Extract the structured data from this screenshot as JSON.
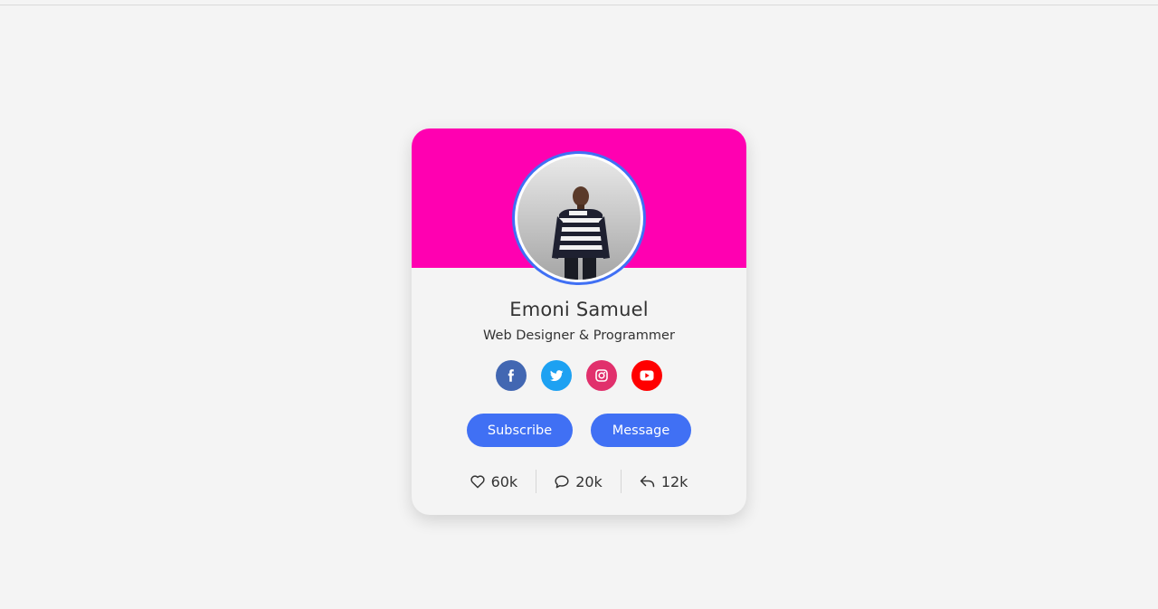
{
  "profile": {
    "name": "Emoni Samuel",
    "role": "Web Designer & Programmer"
  },
  "socials": [
    {
      "network": "facebook",
      "icon": "facebook-icon",
      "color": "#4267b2"
    },
    {
      "network": "twitter",
      "icon": "twitter-icon",
      "color": "#1da1f2"
    },
    {
      "network": "instagram",
      "icon": "instagram-icon",
      "color": "#e1306c"
    },
    {
      "network": "youtube",
      "icon": "youtube-icon",
      "color": "#ff0000"
    }
  ],
  "buttons": {
    "subscribe_label": "Subscribe",
    "message_label": "Message"
  },
  "stats": {
    "likes": "60k",
    "comments": "20k",
    "shares": "12k"
  },
  "colors": {
    "banner": "#ff00b1",
    "accent": "#4070f4",
    "background": "#f4f4f4"
  }
}
